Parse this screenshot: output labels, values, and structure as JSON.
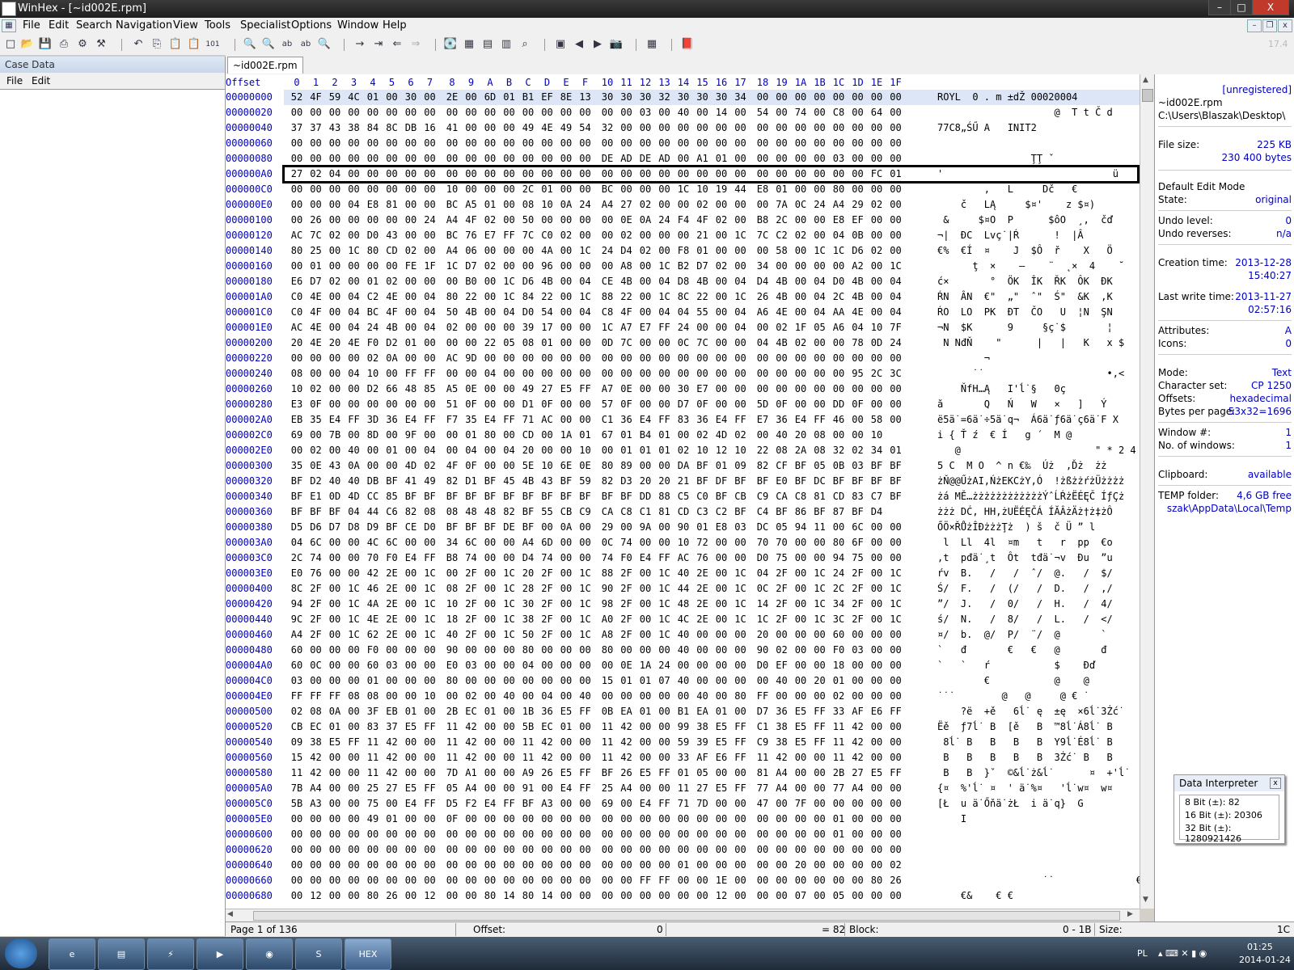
{
  "window": {
    "title": "WinHex - [~id002E.rpm]",
    "minimize": "–",
    "maximize": "□",
    "close": "X",
    "mdi_min": "–",
    "mdi_restore": "❐",
    "mdi_close": "x"
  },
  "menu": [
    "File",
    "Edit",
    "Search",
    "Navigation",
    "View",
    "Tools",
    "Specialist",
    "Options",
    "Window",
    "Help"
  ],
  "toolbar": {
    "version": "17.4",
    "buttons": [
      {
        "name": "new-icon",
        "glyph": "□"
      },
      {
        "name": "open-icon",
        "glyph": "📂"
      },
      {
        "name": "save-icon",
        "glyph": "💾"
      },
      {
        "name": "print-icon",
        "glyph": "⎙"
      },
      {
        "name": "properties-icon",
        "glyph": "⚙"
      },
      {
        "name": "undo-icon",
        "glyph": "↶"
      },
      {
        "name": "copy-icon",
        "glyph": "⎘"
      },
      {
        "name": "paste-icon",
        "glyph": "📋"
      },
      {
        "name": "paste-special-icon",
        "glyph": "📋"
      },
      {
        "name": "copy-hex-icon",
        "glyph": "101"
      },
      {
        "name": "find-text-icon",
        "glyph": "🔍"
      },
      {
        "name": "find-hex-icon",
        "glyph": "🔍"
      },
      {
        "name": "replace-text-icon",
        "glyph": "ab"
      },
      {
        "name": "replace-hex-icon",
        "glyph": "ab"
      },
      {
        "name": "find-next-icon",
        "glyph": "🔍"
      },
      {
        "name": "goto-offset-icon",
        "glyph": "→"
      },
      {
        "name": "goto-sector-icon",
        "glyph": "⇥"
      },
      {
        "name": "back-icon",
        "glyph": "⇐"
      },
      {
        "name": "forward-icon",
        "glyph": "⇒"
      },
      {
        "name": "open-disk-icon",
        "glyph": "💽"
      },
      {
        "name": "disk-editor-icon",
        "glyph": "▦"
      },
      {
        "name": "ram-editor-icon",
        "glyph": "▤"
      },
      {
        "name": "calculator-icon",
        "glyph": "▥"
      },
      {
        "name": "analyze-icon",
        "glyph": "⌕"
      },
      {
        "name": "gallery-icon",
        "glyph": "▣"
      },
      {
        "name": "prev-icon",
        "glyph": "◀"
      },
      {
        "name": "next-icon",
        "glyph": "▶"
      },
      {
        "name": "snapshot-icon",
        "glyph": "📷"
      },
      {
        "name": "table-icon",
        "glyph": "▦"
      },
      {
        "name": "help-icon",
        "glyph": "📕"
      }
    ]
  },
  "case_panel": {
    "title": "Case Data",
    "menu": [
      "File",
      "Edit"
    ]
  },
  "tab": "~id002E.rpm",
  "column_header": {
    "offset": "Offset",
    "cols": [
      "0",
      "1",
      "2",
      "3",
      "4",
      "5",
      "6",
      "7",
      "8",
      "9",
      "A",
      "B",
      "C",
      "D",
      "E",
      "F",
      "10",
      "11",
      "12",
      "13",
      "14",
      "15",
      "16",
      "17",
      "18",
      "19",
      "1A",
      "1B",
      "1C",
      "1D",
      "1E",
      "1F"
    ]
  },
  "rows": [
    {
      "o": "00000000",
      "h": "52 4F 59 4C 01 00 30 00 2E 00 6D 01 B1 EF 8E 13 30 30 30 32 30 30 30 34 00 00 00 00 00 00 00 00",
      "a": "ROYL  0 . m ±dŽ 00020004"
    },
    {
      "o": "00000020",
      "h": "00 00 00 00 00 00 00 00 00 00 00 00 00 00 00 00 00 00 03 00 40 00 14 00 54 00 74 00 C8 00 64 00",
      "a": "                    @  T t Č d"
    },
    {
      "o": "00000040",
      "h": "37 37 43 38 84 8C DB 16 41 00 00 00 49 4E 49 54 32 00 00 00 00 00 00 00 00 00 00 00 00 00 00 00",
      "a": "77C8„ŚŰ A   INIT2"
    },
    {
      "o": "00000060",
      "h": "00 00 00 00 00 00 00 00 00 00 00 00 00 00 00 00 00 00 00 00 00 00 00 00 00 00 00 00 00 00 00 00",
      "a": ""
    },
    {
      "o": "00000080",
      "h": "00 00 00 00 00 00 00 00 00 00 00 00 00 00 00 00 DE AD DE AD 00 A1 01 00 00 00 00 00 03 00 00 00",
      "a": "                Ţ­Ţ­ ˇ"
    },
    {
      "o": "000000A0",
      "h": "27 02 04 00 00 00 00 00 00 00 00 00 00 00 00 00 00 00 00 00 00 00 00 00 00 00 00 00 00 00 FC 01",
      "a": "'                             ü"
    },
    {
      "o": "000000C0",
      "h": "00 00 00 00 00 00 00 00 10 00 00 00 2C 01 00 00 BC 00 00 00 1C 10 19 44 E8 01 00 00 80 00 00 00",
      "a": "        ,   L     Dč   €"
    },
    {
      "o": "000000E0",
      "h": "00 00 00 04 E8 81 00 00 BC A5 01 00 08 10 0A 24 A4 27 02 00 00 02 00 00 00 7A 0C 24 A4 29 02 00",
      "a": "    č   LĄ     $¤'    z $¤)"
    },
    {
      "o": "00000100",
      "h": "00 26 00 00 00 00 00 24 A4 4F 02 00 50 00 00 00 00 0E 0A 24 F4 4F 02 00 B8 2C 00 00 E8 EF 00 00",
      "a": " &     $¤O  P      $ôO  ¸,  čď"
    },
    {
      "o": "00000120",
      "h": "AC 7C 02 00 D0 43 00 00 BC 76 E7 FF 7C C0 02 00 00 02 00 00 00 21 00 1C 7C C2 02 00 04 0B 00 00",
      "a": "¬|  ĐC  Lvç˙|Ŕ      !  |Â"
    },
    {
      "o": "00000140",
      "h": "80 25 00 1C 80 CD 02 00 A4 06 00 00 00 4A 00 1C 24 D4 02 00 F8 01 00 00 00 58 00 1C 1C D6 02 00",
      "a": "€%  €Í  ¤    J  $Ô  ř    X   Ö"
    },
    {
      "o": "00000160",
      "h": "00 01 00 00 00 00 FE 1F 1C D7 02 00 00 96 00 00 00 A8 00 1C B2 D7 02 00 34 00 00 00 00 A2 00 1C",
      "a": "      ţ  ×    –    ¨  ˛×  4    ˘"
    },
    {
      "o": "00000180",
      "h": "E6 D7 02 00 01 02 00 00 00 B0 00 1C D6 4B 00 04 CE 4B 00 04 D8 4B 00 04 D4 4B 00 04 D0 4B 00 04",
      "a": "ć×       °  ÖK  ÎK  ŘK  ÔK  ĐK"
    },
    {
      "o": "000001A0",
      "h": "C0 4E 00 04 C2 4E 00 04 80 22 00 1C 84 22 00 1C 88 22 00 1C 8C 22 00 1C 26 4B 00 04 2C 4B 00 04",
      "a": "ŔN  ÂN  €\"  „\"  ˆ\"  Ś\"  &K  ,K"
    },
    {
      "o": "000001C0",
      "h": "C0 4F 00 04 BC 4F 00 04 50 4B 00 04 D0 54 00 04 C8 4F 00 04 04 55 00 04 A6 4E 00 04 AA 4E 00 04",
      "a": "ŔO  LO  PK  ĐT  ČO   U  ¦N  ŞN"
    },
    {
      "o": "000001E0",
      "h": "AC 4E 00 04 24 4B 00 04 02 00 00 00 39 17 00 00 1C A7 E7 FF 24 00 00 04 00 02 1F 05 A6 04 10 7F",
      "a": "¬N  $K      9     §ç˙$       ¦"
    },
    {
      "o": "00000200",
      "h": "20 4E 20 4E F0 D2 01 00 00 00 22 05 08 01 00 00 0D 7C 00 00 0C 7C 00 00 04 4B 02 00 00 78 0D 24",
      "a": " N NđŇ    \"      |   |   K   x $"
    },
    {
      "o": "00000220",
      "h": "00 00 00 00 02 0A 00 00 AC 9D 00 00 00 00 00 00 00 00 00 00 00 00 00 00 00 00 00 00 00 00 00 00",
      "a": "        ¬"
    },
    {
      "o": "00000240",
      "h": "08 00 00 04 10 00 FF FF 00 00 04 00 00 00 00 00 00 00 00 00 00 00 00 00 00 00 00 00 00 95 2C 3C",
      "a": "      ˙˙                     •,<"
    },
    {
      "o": "00000260",
      "h": "10 02 00 00 D2 66 48 85 A5 0E 00 00 49 27 E5 FF A7 0E 00 00 30 E7 00 00 00 00 00 00 00 00 00 00",
      "a": "    ŇfH…Ą   I'ĺ˙§   0ç"
    },
    {
      "o": "00000280",
      "h": "E3 0F 00 00 00 00 00 00 51 0F 00 00 D1 0F 00 00 57 0F 00 00 D7 0F 00 00 5D 0F 00 00 DD 0F 00 00",
      "a": "ă       Q   Ń   W   ×   ]   Ý"
    },
    {
      "o": "000002A0",
      "h": "EB 35 E4 FF 3D 36 E4 FF F7 35 E4 FF 71 AC 00 00 C1 36 E4 FF 83 36 E4 FF E7 36 E4 FF 46 00 58 00",
      "a": "ë5ä˙=6ä˙÷5ä˙q¬  Á6ä˙ƒ6ä˙ç6ä˙F X"
    },
    {
      "o": "000002C0",
      "h": "69 00 7B 00 8D 00 9F 00 00 01 80 00 CD 00 1A 01 67 01 B4 01 00 02 4D 02 00 40 20 08 00 00 10",
      "a": "i { Ť ź  € Í   g ´  M @"
    },
    {
      "o": "000002E0",
      "h": "00 02 00 40 00 01 00 04 00 04 00 04 20 00 00 10 00 01 01 01 02 10 12 10 22 08 2A 08 32 02 34 01",
      "a": "   @                       \" * 2 4"
    },
    {
      "o": "00000300",
      "h": "35 0E 43 0A 00 00 4D 02 4F 0F 00 00 5E 10 6E 0E 80 89 00 00 DA BF 01 09 82 CF BF 05 0B 03 BF BF",
      "a": "5 C  M O  ^ n €‰  Úż  ‚Ďż  żż"
    },
    {
      "o": "00000320",
      "h": "BF D2 40 40 DB BF 41 49 82 D1 BF 45 4B 43 BF 59 82 D3 20 20 21 BF DF BF BF E0 BF DC BF BF BF BF",
      "a": "żŇ@@ŰżAI‚ŃżEKCżY‚Ó  !żßżżŕżÜżżżż"
    },
    {
      "o": "00000340",
      "h": "BF E1 0D 4D CC 85 BF BF BF BF BF BF BF BF BF BF BF BF DD 88 C5 C0 BF CB C9 CA C8 81 CD 83 C7 BF",
      "a": "żá MĚ…żżżżżżżżżżżżÝˆĹŔżËÉĘČ ÍƒÇż"
    },
    {
      "o": "00000360",
      "h": "BF BF BF 04 44 C6 82 08 08 48 48 82 BF 55 CB C9 CA C8 C1 81 CD C3 C2 BF C4 BF 86 BF 87 BF D4",
      "a": "żżż DĆ‚ HH‚żUËÉĘČÁ ÍĂÂżÄż†ż‡żÔ"
    },
    {
      "o": "00000380",
      "h": "D5 D6 D7 D8 D9 BF CE D0 BF BF BF DE BF 00 0A 00 29 00 9A 00 90 01 E8 03 DC 05 94 11 00 6C 00 00",
      "a": "ŐÖ×ŘŮżÎĐżżżŢż  ) š  č Ü ” l"
    },
    {
      "o": "000003A0",
      "h": "04 6C 00 00 4C 6C 00 00 34 6C 00 00 A4 6D 00 00 0C 74 00 00 10 72 00 00 70 70 00 00 80 6F 00 00",
      "a": " l  Ll  4l  ¤m   t   r  pp  €o"
    },
    {
      "o": "000003C0",
      "h": "2C 74 00 00 70 F0 E4 FF B8 74 00 00 D4 74 00 00 74 F0 E4 FF AC 76 00 00 D0 75 00 00 94 75 00 00",
      "a": ",t  pđä˙¸t  Ôt  tđä˙¬v  Đu  ”u"
    },
    {
      "o": "000003E0",
      "h": "E0 76 00 00 42 2E 00 1C 00 2F 00 1C 20 2F 00 1C 88 2F 00 1C 40 2E 00 1C 04 2F 00 1C 24 2F 00 1C",
      "a": "ŕv  B.   /   /  ˆ/  @.   /  $/"
    },
    {
      "o": "00000400",
      "h": "8C 2F 00 1C 46 2E 00 1C 08 2F 00 1C 28 2F 00 1C 90 2F 00 1C 44 2E 00 1C 0C 2F 00 1C 2C 2F 00 1C",
      "a": "Ś/  F.   /  (/   /  D.   /  ,/"
    },
    {
      "o": "00000420",
      "h": "94 2F 00 1C 4A 2E 00 1C 10 2F 00 1C 30 2F 00 1C 98 2F 00 1C 48 2E 00 1C 14 2F 00 1C 34 2F 00 1C",
      "a": "”/  J.   /  0/   /  H.   /  4/"
    },
    {
      "o": "00000440",
      "h": "9C 2F 00 1C 4E 2E 00 1C 18 2F 00 1C 38 2F 00 1C A0 2F 00 1C 4C 2E 00 1C 1C 2F 00 1C 3C 2F 00 1C",
      "a": "ś/  N.   /  8/   /  L.   /  </"
    },
    {
      "o": "00000460",
      "h": "A4 2F 00 1C 62 2E 00 1C 40 2F 00 1C 50 2F 00 1C A8 2F 00 1C 40 00 00 00 20 00 00 00 60 00 00 00",
      "a": "¤/  b.  @/  P/  ¨/  @       `"
    },
    {
      "o": "00000480",
      "h": "60 00 00 00 F0 00 00 00 90 00 00 00 80 00 00 00 80 00 00 00 40 00 00 00 90 02 00 00 F0 03 00 00",
      "a": "`   đ       €   €   @       đ"
    },
    {
      "o": "000004A0",
      "h": "60 0C 00 00 60 03 00 00 E0 03 00 00 04 00 00 00 00 0E 1A 24 00 00 00 00 D0 EF 00 00 18 00 00 00",
      "a": "`   `   ŕ           $    Đď"
    },
    {
      "o": "000004C0",
      "h": "03 00 00 00 01 00 00 00 80 00 00 00 00 00 00 00 15 01 01 07 40 00 00 00 00 40 00 20 01 00 00 00",
      "a": "        €           @    @"
    },
    {
      "o": "000004E0",
      "h": "FF FF FF 08 08 00 00 10 00 02 00 40 00 04 00 40 00 00 00 00 00 40 00 80 FF 00 00 00 02 00 00 00",
      "a": "˙˙˙        @   @     @ € ˙"
    },
    {
      "o": "00000500",
      "h": "02 08 0A 00 3F EB 01 00 2B EC 01 00 1B 36 E5 FF 0B EA 01 00 B1 EA 01 00 D7 36 E5 FF 33 AF E6 FF",
      "a": "    ?ë  +ě   6ĺ˙ ę  ±ę  ×6ĺ˙3Żć˙"
    },
    {
      "o": "00000520",
      "h": "CB EC 01 00 83 37 E5 FF 11 42 00 00 5B EC 01 00 11 42 00 00 99 38 E5 FF C1 38 E5 FF 11 42 00 00",
      "a": "Ëě  ƒ7ĺ˙ B  [ě   B  ™8ĺ˙Á8ĺ˙ B"
    },
    {
      "o": "00000540",
      "h": "09 38 E5 FF 11 42 00 00 11 42 00 00 11 42 00 00 11 42 00 00 59 39 E5 FF C9 38 E5 FF 11 42 00 00",
      "a": " 8ĺ˙ B   B   B   B  Y9ĺ˙É8ĺ˙ B"
    },
    {
      "o": "00000560",
      "h": "15 42 00 00 11 42 00 00 11 42 00 00 11 42 00 00 11 42 00 00 33 AF E6 FF 11 42 00 00 11 42 00 00",
      "a": " B   B   B   B   B  3Żć˙ B   B"
    },
    {
      "o": "00000580",
      "h": "11 42 00 00 11 42 00 00 7D A1 00 00 A9 26 E5 FF BF 26 E5 FF 01 05 00 00 81 A4 00 00 2B 27 E5 FF",
      "a": " B   B  }ˇ  ©&ĺ˙ż&ĺ˙      ¤  +'ĺ˙"
    },
    {
      "o": "000005A0",
      "h": "7B A4 00 00 25 27 E5 FF 05 A4 00 00 91 00 E4 FF 25 A4 00 00 11 27 E5 FF 77 A4 00 00 77 A4 00 00",
      "a": "{¤  %'ĺ˙ ¤  ' ä˙%¤   'ĺ˙w¤  w¤"
    },
    {
      "o": "000005C0",
      "h": "5B A3 00 00 75 00 E4 FF D5 F2 E4 FF BF A3 00 00 69 00 E4 FF 71 7D 00 00 47 00 7F 00 00 00 00 00",
      "a": "[Ł  u ä˙Őňä˙żŁ  i ä˙q}  G"
    },
    {
      "o": "000005E0",
      "h": "00 00 00 00 49 01 00 00 0F 00 00 00 00 00 00 00 00 00 00 00 00 00 00 00 00 00 00 00 01 00 00 00",
      "a": "    I"
    },
    {
      "o": "00000600",
      "h": "00 00 00 00 00 00 00 00 00 00 00 00 00 00 00 00 00 00 00 00 00 00 00 00 00 00 00 00 01 00 00 00",
      "a": ""
    },
    {
      "o": "00000620",
      "h": "00 00 00 00 00 00 00 00 00 00 00 00 00 00 00 00 00 00 00 00 00 00 00 00 00 00 00 00 00 00 00 00",
      "a": ""
    },
    {
      "o": "00000640",
      "h": "00 00 00 00 00 00 00 00 00 00 00 00 00 00 00 00 00 00 00 00 01 00 00 00 00 00 20 00 00 00 00 02",
      "a": ""
    },
    {
      "o": "00000660",
      "h": "00 00 00 00 00 00 00 00 00 00 00 00 00 00 00 00 00 00 FF FF 00 00 1E 00 00 00 00 00 00 00 80 26",
      "a": "                  ˙˙              €&"
    },
    {
      "o": "00000680",
      "h": "00 12 00 00 80 26 00 12 00 00 80 14 80 14 00 00 00 00 00 00 00 00 12 00 00 00 07 00 05 00 00 00",
      "a": "    €&    € €"
    }
  ],
  "info": {
    "unregistered": "[unregistered]",
    "filename": "~id002E.rpm",
    "path": "C:\\Users\\Blaszak\\Desktop\\",
    "file_size_label": "File size:",
    "file_size_kb": "225 KB",
    "file_size_bytes": "230 400 bytes",
    "edit_mode_label": "Default Edit Mode",
    "state_label": "State:",
    "state": "original",
    "undo_level_label": "Undo level:",
    "undo_level": "0",
    "undo_reverses_label": "Undo reverses:",
    "undo_reverses": "n/a",
    "creation_label": "Creation time:",
    "creation_date": "2013-12-28",
    "creation_time": "15:40:27",
    "write_label": "Last write time:",
    "write_date": "2013-11-27",
    "write_time": "02:57:16",
    "attributes_label": "Attributes:",
    "attributes": "A",
    "icons_label": "Icons:",
    "icons": "0",
    "mode_label": "Mode:",
    "mode": "Text",
    "charset_label": "Character set:",
    "charset": "CP 1250",
    "offsets_label": "Offsets:",
    "offsets": "hexadecimal",
    "bpp_label": "Bytes per page:",
    "bpp": "53x32=1696",
    "window_num_label": "Window #:",
    "window_num": "1",
    "num_windows_label": "No. of windows:",
    "num_windows": "1",
    "clipboard_label": "Clipboard:",
    "clipboard": "available",
    "temp_label": "TEMP folder:",
    "temp_free": "4,6 GB free",
    "temp_path": "szak\\AppData\\Local\\Temp"
  },
  "data_interpreter": {
    "title": "Data Interpreter",
    "close": "x",
    "b8": "8 Bit (±): 82",
    "b16": "16 Bit (±): 20306",
    "b32": "32 Bit (±): 1280921426"
  },
  "status": {
    "page": "Page 1 of 136",
    "offset_label": "Offset:",
    "offset_value": "0",
    "value": "= 82",
    "block_label": "Block:",
    "block_value": "0 - 1B",
    "size_label": "Size:",
    "size_value": "1C"
  },
  "taskbar": {
    "apps": [
      {
        "name": "ie-icon",
        "label": "e"
      },
      {
        "name": "explorer-icon",
        "label": "▤"
      },
      {
        "name": "winamp-icon",
        "label": "⚡"
      },
      {
        "name": "media-player-icon",
        "label": "▶"
      },
      {
        "name": "firefox-icon",
        "label": "◉"
      },
      {
        "name": "skype-icon",
        "label": "S"
      },
      {
        "name": "winhex-taskbar-icon",
        "label": "HEX"
      }
    ],
    "lang": "PL",
    "time": "01:25",
    "date": "2014-01-24"
  }
}
